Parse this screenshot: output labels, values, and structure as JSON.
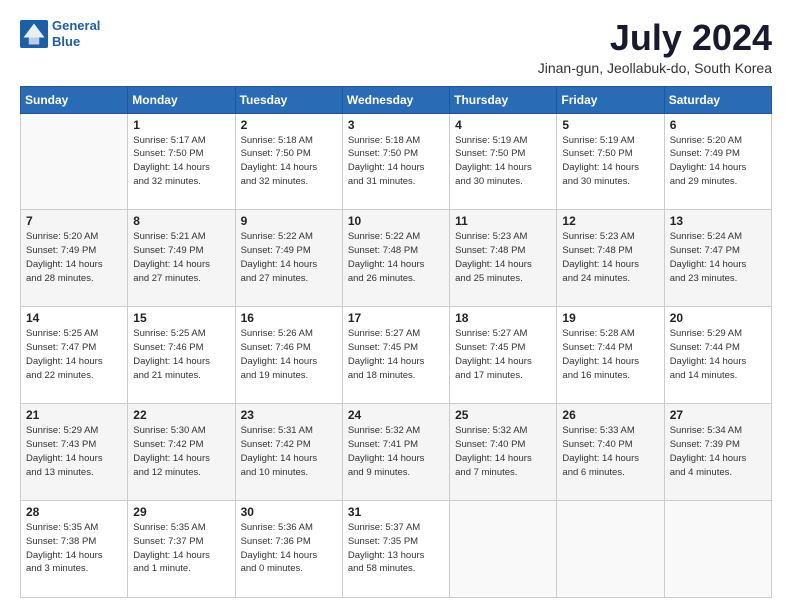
{
  "logo": {
    "line1": "General",
    "line2": "Blue"
  },
  "title": "July 2024",
  "location": "Jinan-gun, Jeollabuk-do, South Korea",
  "weekdays": [
    "Sunday",
    "Monday",
    "Tuesday",
    "Wednesday",
    "Thursday",
    "Friday",
    "Saturday"
  ],
  "weeks": [
    [
      {
        "day": null
      },
      {
        "day": "1",
        "sunrise": "5:17 AM",
        "sunset": "7:50 PM",
        "daylight": "14 hours and 32 minutes."
      },
      {
        "day": "2",
        "sunrise": "5:18 AM",
        "sunset": "7:50 PM",
        "daylight": "14 hours and 32 minutes."
      },
      {
        "day": "3",
        "sunrise": "5:18 AM",
        "sunset": "7:50 PM",
        "daylight": "14 hours and 31 minutes."
      },
      {
        "day": "4",
        "sunrise": "5:19 AM",
        "sunset": "7:50 PM",
        "daylight": "14 hours and 30 minutes."
      },
      {
        "day": "5",
        "sunrise": "5:19 AM",
        "sunset": "7:50 PM",
        "daylight": "14 hours and 30 minutes."
      },
      {
        "day": "6",
        "sunrise": "5:20 AM",
        "sunset": "7:49 PM",
        "daylight": "14 hours and 29 minutes."
      }
    ],
    [
      {
        "day": "7",
        "sunrise": "5:20 AM",
        "sunset": "7:49 PM",
        "daylight": "14 hours and 28 minutes."
      },
      {
        "day": "8",
        "sunrise": "5:21 AM",
        "sunset": "7:49 PM",
        "daylight": "14 hours and 27 minutes."
      },
      {
        "day": "9",
        "sunrise": "5:22 AM",
        "sunset": "7:49 PM",
        "daylight": "14 hours and 27 minutes."
      },
      {
        "day": "10",
        "sunrise": "5:22 AM",
        "sunset": "7:48 PM",
        "daylight": "14 hours and 26 minutes."
      },
      {
        "day": "11",
        "sunrise": "5:23 AM",
        "sunset": "7:48 PM",
        "daylight": "14 hours and 25 minutes."
      },
      {
        "day": "12",
        "sunrise": "5:23 AM",
        "sunset": "7:48 PM",
        "daylight": "14 hours and 24 minutes."
      },
      {
        "day": "13",
        "sunrise": "5:24 AM",
        "sunset": "7:47 PM",
        "daylight": "14 hours and 23 minutes."
      }
    ],
    [
      {
        "day": "14",
        "sunrise": "5:25 AM",
        "sunset": "7:47 PM",
        "daylight": "14 hours and 22 minutes."
      },
      {
        "day": "15",
        "sunrise": "5:25 AM",
        "sunset": "7:46 PM",
        "daylight": "14 hours and 21 minutes."
      },
      {
        "day": "16",
        "sunrise": "5:26 AM",
        "sunset": "7:46 PM",
        "daylight": "14 hours and 19 minutes."
      },
      {
        "day": "17",
        "sunrise": "5:27 AM",
        "sunset": "7:45 PM",
        "daylight": "14 hours and 18 minutes."
      },
      {
        "day": "18",
        "sunrise": "5:27 AM",
        "sunset": "7:45 PM",
        "daylight": "14 hours and 17 minutes."
      },
      {
        "day": "19",
        "sunrise": "5:28 AM",
        "sunset": "7:44 PM",
        "daylight": "14 hours and 16 minutes."
      },
      {
        "day": "20",
        "sunrise": "5:29 AM",
        "sunset": "7:44 PM",
        "daylight": "14 hours and 14 minutes."
      }
    ],
    [
      {
        "day": "21",
        "sunrise": "5:29 AM",
        "sunset": "7:43 PM",
        "daylight": "14 hours and 13 minutes."
      },
      {
        "day": "22",
        "sunrise": "5:30 AM",
        "sunset": "7:42 PM",
        "daylight": "14 hours and 12 minutes."
      },
      {
        "day": "23",
        "sunrise": "5:31 AM",
        "sunset": "7:42 PM",
        "daylight": "14 hours and 10 minutes."
      },
      {
        "day": "24",
        "sunrise": "5:32 AM",
        "sunset": "7:41 PM",
        "daylight": "14 hours and 9 minutes."
      },
      {
        "day": "25",
        "sunrise": "5:32 AM",
        "sunset": "7:40 PM",
        "daylight": "14 hours and 7 minutes."
      },
      {
        "day": "26",
        "sunrise": "5:33 AM",
        "sunset": "7:40 PM",
        "daylight": "14 hours and 6 minutes."
      },
      {
        "day": "27",
        "sunrise": "5:34 AM",
        "sunset": "7:39 PM",
        "daylight": "14 hours and 4 minutes."
      }
    ],
    [
      {
        "day": "28",
        "sunrise": "5:35 AM",
        "sunset": "7:38 PM",
        "daylight": "14 hours and 3 minutes."
      },
      {
        "day": "29",
        "sunrise": "5:35 AM",
        "sunset": "7:37 PM",
        "daylight": "14 hours and 1 minute."
      },
      {
        "day": "30",
        "sunrise": "5:36 AM",
        "sunset": "7:36 PM",
        "daylight": "14 hours and 0 minutes."
      },
      {
        "day": "31",
        "sunrise": "5:37 AM",
        "sunset": "7:35 PM",
        "daylight": "13 hours and 58 minutes."
      },
      {
        "day": null
      },
      {
        "day": null
      },
      {
        "day": null
      }
    ]
  ]
}
